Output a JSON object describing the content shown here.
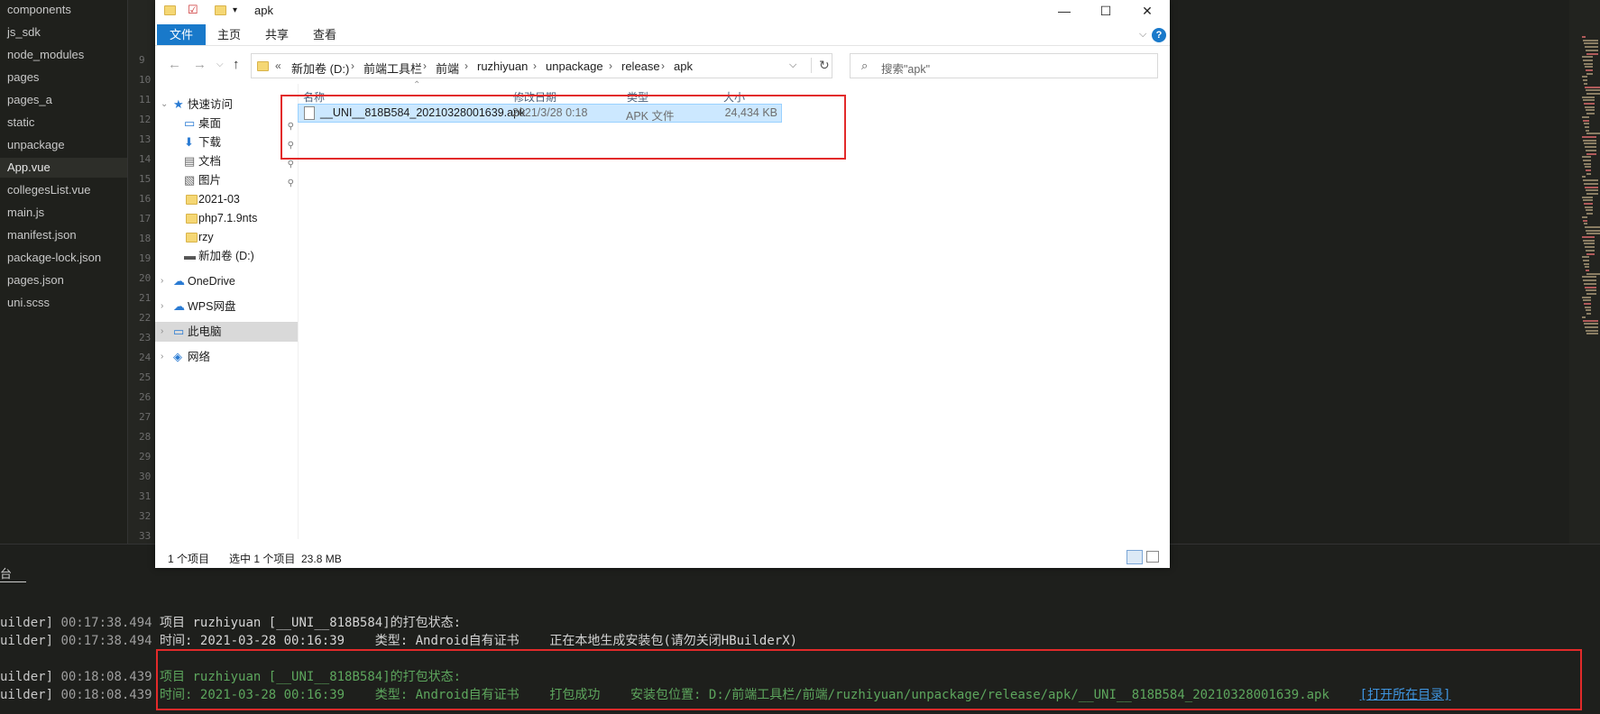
{
  "editor": {
    "tree": [
      "components",
      "js_sdk",
      "node_modules",
      "pages",
      "pages_a",
      "static",
      "unpackage",
      "App.vue",
      "collegesList.vue",
      "main.js",
      "manifest.json",
      "package-lock.json",
      "pages.json",
      "uni.scss"
    ],
    "active_item": "App.vue",
    "line_numbers": [
      "9",
      "10",
      "11",
      "12",
      "13",
      "14",
      "15",
      "16",
      "17",
      "18",
      "19",
      "20",
      "21",
      "22",
      "23",
      "24",
      "25",
      "26",
      "27",
      "28",
      "29",
      "30",
      "31",
      "32",
      "33"
    ]
  },
  "explorer": {
    "title": "apk",
    "window_controls": {
      "minimize": "—",
      "maximize": "☐",
      "close": "✕"
    },
    "ribbon_tabs": [
      "文件",
      "主页",
      "共享",
      "查看"
    ],
    "help_icon": "?",
    "breadcrumb": [
      "新加卷 (D:)",
      "前端工具栏",
      "前端",
      "ruzhiyuan",
      "unpackage",
      "release",
      "apk"
    ],
    "breadcrumb_prefix": "«",
    "search_placeholder": "搜索\"apk\"",
    "nav_items": [
      {
        "label": "快速访问",
        "icon": "star-icon",
        "level": 0
      },
      {
        "label": "桌面",
        "icon": "desktop-icon",
        "level": 1,
        "pinned": true
      },
      {
        "label": "下载",
        "icon": "download-icon",
        "level": 1,
        "pinned": true
      },
      {
        "label": "文档",
        "icon": "document-icon",
        "level": 1,
        "pinned": true
      },
      {
        "label": "图片",
        "icon": "picture-icon",
        "level": 1,
        "pinned": true
      },
      {
        "label": "2021-03",
        "icon": "folder-icon",
        "level": 1
      },
      {
        "label": "php7.1.9nts",
        "icon": "folder-icon",
        "level": 1
      },
      {
        "label": "rzy",
        "icon": "folder-icon",
        "level": 1
      },
      {
        "label": "新加卷 (D:)",
        "icon": "drive-icon",
        "level": 1
      },
      {
        "label": "OneDrive",
        "icon": "cloud-icon",
        "level": 0
      },
      {
        "label": "WPS网盘",
        "icon": "cloud-icon",
        "level": 0
      },
      {
        "label": "此电脑",
        "icon": "pc-icon",
        "level": 0,
        "selected": true
      },
      {
        "label": "网络",
        "icon": "network-icon",
        "level": 0
      }
    ],
    "columns": [
      "名称",
      "修改日期",
      "类型",
      "大小"
    ],
    "file": {
      "name": "__UNI__818B584_20210328001639.apk",
      "modified": "2021/3/28 0:18",
      "type": "APK 文件",
      "size": "24,434 KB"
    },
    "status": {
      "count": "1 个项目",
      "selected": "选中 1 个项目  23.8 MB"
    }
  },
  "console": {
    "tab": "台",
    "logs": [
      {
        "prefix": "uilder]",
        "time": "00:17:38.494",
        "text": "项目 ruzhiyuan [__UNI__818B584]的打包状态:",
        "green": false
      },
      {
        "prefix": "uilder]",
        "time": "00:17:38.494",
        "text": "时间: 2021-03-28 00:16:39    类型: Android自有证书    正在本地生成安装包(请勿关闭HBuilderX)",
        "green": false
      },
      {
        "prefix": "uilder]",
        "time": "00:18:08.439",
        "text": "项目 ruzhiyuan [__UNI__818B584]的打包状态:",
        "green": true
      },
      {
        "prefix": "uilder]",
        "time": "00:18:08.439",
        "text": "时间: 2021-03-28 00:16:39    类型: Android自有证书    打包成功    安装包位置: D:/前端工具栏/前端/ruzhiyuan/unpackage/release/apk/__UNI__818B584_20210328001639.apk    ",
        "green": true,
        "link": "[打开所在目录]"
      }
    ]
  }
}
